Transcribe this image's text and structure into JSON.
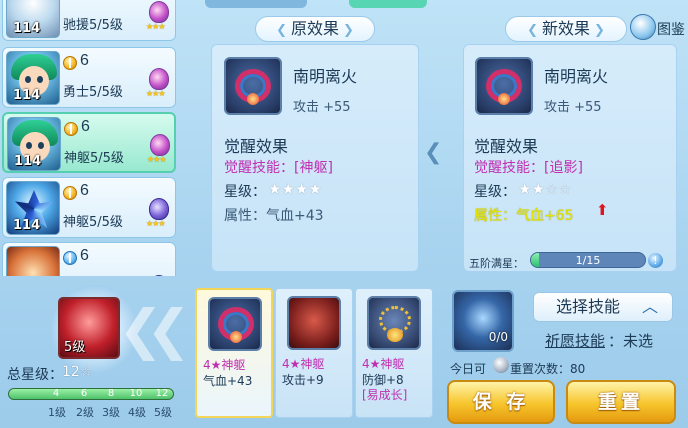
{
  "roster": [
    {
      "level": "114",
      "value": "",
      "sub": "驰援5/5级"
    },
    {
      "level": "114",
      "value": "6",
      "sub": "勇士5/5级"
    },
    {
      "level": "114",
      "value": "6",
      "sub": "神躯5/5级"
    },
    {
      "level": "114",
      "value": "6",
      "sub": "神躯5/5级"
    },
    {
      "level": "",
      "value": "6",
      "sub": ""
    }
  ],
  "original": {
    "title": "原效果",
    "item_name": "南明离火",
    "attack": "攻击 +55",
    "awaken_title": "觉醒效果",
    "skill": "觉醒技能：[神躯]",
    "star_label": "星级：",
    "stars": "★★★★",
    "attr": "属性：气血+43"
  },
  "new": {
    "title": "新效果",
    "item_name": "南明离火",
    "attack": "攻击 +55",
    "awaken_title": "觉醒效果",
    "skill": "觉醒技能：[追影]",
    "star_label": "星级：",
    "stars": "★★☆☆",
    "attr": "属性：气血+65",
    "up_arrow": "⬆",
    "tier_label": "五阶满星：",
    "progress_text": "1/15",
    "progress_value": 0.067,
    "help": "!"
  },
  "top_right": {
    "label": "图鉴"
  },
  "bottom_left": {
    "portrait_level": "5级",
    "total_star_label": "总星级：",
    "total_star_value": "12☆",
    "star_marks": [
      "4",
      "6",
      "8",
      "10",
      "12"
    ],
    "level_marks": [
      "1级",
      "2级",
      "3级",
      "4级",
      "5级"
    ],
    "star_progress": 1.0
  },
  "options": [
    {
      "l1": "4★神躯",
      "l2": "气血+43",
      "l3": ""
    },
    {
      "l1": "4★神躯",
      "l2": "攻击+9",
      "l3": ""
    },
    {
      "l1": "4★神躯",
      "l2": "防御+8",
      "l3": "[易成长]"
    }
  ],
  "right_bottom": {
    "orb_count": "0/0",
    "select_skill": "选择技能",
    "wish_label": "祈愿技能",
    "wish_value": "：未选",
    "today_label": "今日可",
    "reset_label": "重置次数：80",
    "save_button": "保 存",
    "reset_button": "重置"
  }
}
